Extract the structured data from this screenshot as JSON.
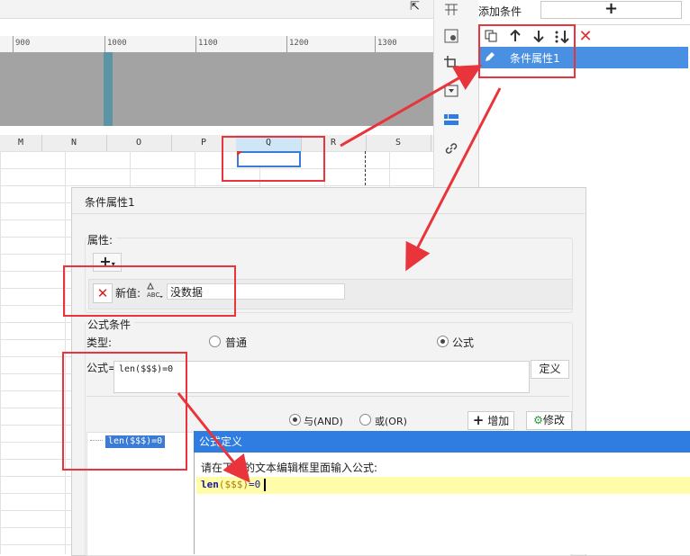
{
  "ruler": {
    "ticks": [
      "900",
      "1000",
      "1100",
      "1200",
      "1300"
    ]
  },
  "sheet": {
    "columns": [
      "M",
      "N",
      "O",
      "P",
      "Q",
      "R",
      "S"
    ]
  },
  "right_panel": {
    "add_condition_label": "添加条件",
    "add_button": "+",
    "condition_item": "条件属性1",
    "toolbar": [
      "copy-icon",
      "arrow-up-icon",
      "arrow-down-icon",
      "sort-icon",
      "delete-icon"
    ]
  },
  "prop_dialog": {
    "title": "条件属性1",
    "property_label": "属性:",
    "add_property": "+",
    "new_value_label": "新值:",
    "new_value": "没数据",
    "formula_condition_label": "公式条件",
    "type_label": "类型:",
    "type_options": [
      "普通",
      "公式"
    ],
    "type_selected": "公式",
    "formula_label": "公式=",
    "formula_value": "len($$$)=0",
    "define_button": "定义",
    "logic_and": "与(AND)",
    "logic_or": "或(OR)",
    "logic_selected": "与(AND)",
    "add_button": "增加",
    "modify_button": "修改",
    "condition_list": [
      "len($$$)=0"
    ]
  },
  "formula_dialog": {
    "title": "公式定义",
    "prompt": "请在下面的文本编辑框里面输入公式:",
    "code_fn": "len",
    "code_paren_open": "(",
    "code_arg": "$$$",
    "code_paren_close": ")",
    "code_rest": "=0"
  },
  "colors": {
    "accent": "#4a90e2",
    "annotation": "#e8343a",
    "editor_highlight": "#fffcaa"
  }
}
